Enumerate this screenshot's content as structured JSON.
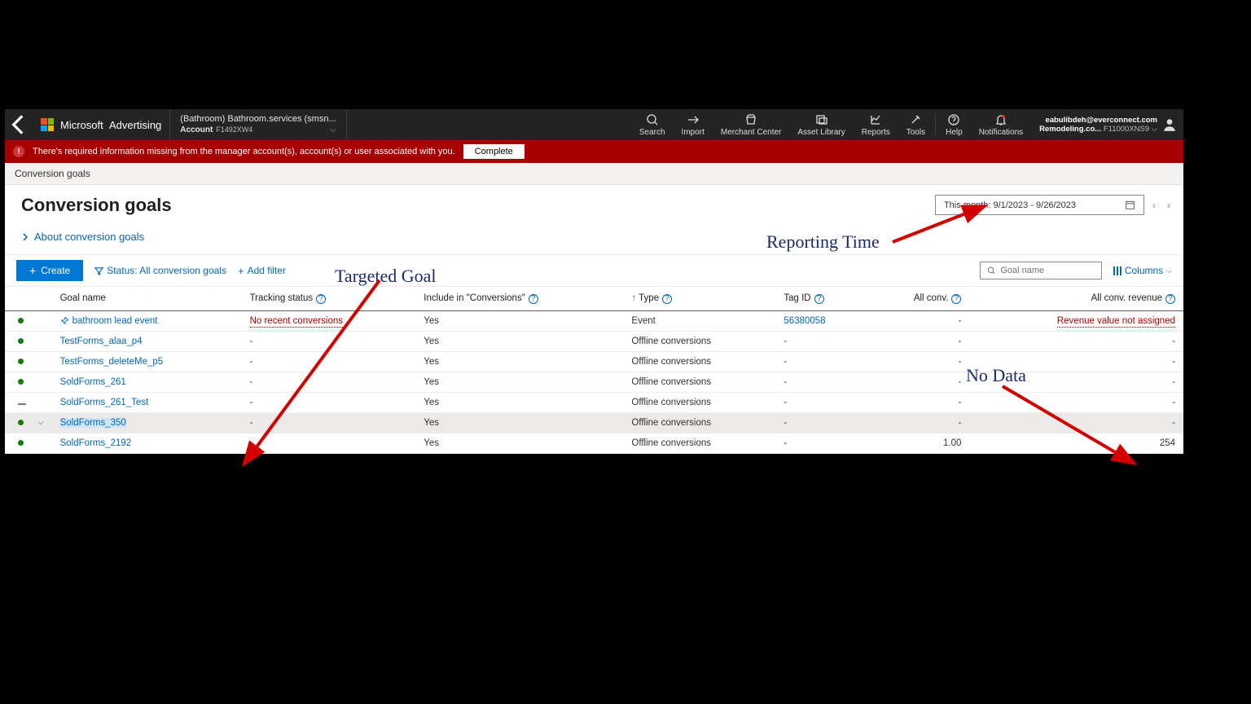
{
  "topbar": {
    "brand": "Microsoft",
    "brand2": "Advertising",
    "acct_line1": "(Bathroom) Bathroom.services (smsn...",
    "acct_label": "Account",
    "acct_id": "F1492XW4",
    "tools": {
      "search": "Search",
      "import": "Import",
      "merchant": "Merchant Center",
      "asset": "Asset Library",
      "reports": "Reports",
      "tools_lbl": "Tools",
      "help": "Help",
      "notifications": "Notifications"
    },
    "user_line1": "eabulibdeh@everconnect.com",
    "user_line2_a": "Remodeling.co...",
    "user_line2_b": "F11000XNS9"
  },
  "alert": {
    "text": "There's required information missing from the manager account(s), account(s) or user associated with you.",
    "button": "Complete"
  },
  "crumb": "Conversion goals",
  "page": {
    "title": "Conversion goals",
    "about": "About conversion goals",
    "date_range": "This month: 9/1/2023 - 9/26/2023"
  },
  "toolbar": {
    "create": "Create",
    "status_filter": "Status: All conversion goals",
    "add_filter": "Add filter",
    "search_placeholder": "Goal name",
    "columns": "Columns"
  },
  "columns": {
    "goal": "Goal name",
    "tracking": "Tracking status",
    "include": "Include in \"Conversions\"",
    "type": "Type",
    "tag": "Tag ID",
    "allconv": "All conv.",
    "allconvrev": "All conv. revenue"
  },
  "rows": [
    {
      "status": "dot",
      "name": "bathroom lead event",
      "pin": true,
      "tracking": "No recent conversions",
      "tracking_warn": true,
      "include": "Yes",
      "type": "Event",
      "tag": "56380058",
      "tag_link": true,
      "allconv": "-",
      "allconvrev": "Revenue value not assigned",
      "rev_warn": true
    },
    {
      "status": "dot",
      "name": "TestForms_alaa_p4",
      "tracking": "-",
      "include": "Yes",
      "type": "Offline conversions",
      "tag": "-",
      "allconv": "-",
      "allconvrev": "-"
    },
    {
      "status": "dot",
      "name": "TestForms_deleteMe_p5",
      "tracking": "-",
      "include": "Yes",
      "type": "Offline conversions",
      "tag": "-",
      "allconv": "-",
      "allconvrev": "-"
    },
    {
      "status": "dot",
      "name": "SoldForms_261",
      "tracking": "-",
      "include": "Yes",
      "type": "Offline conversions",
      "tag": "-",
      "allconv": "-",
      "allconvrev": "-"
    },
    {
      "status": "dash",
      "name": "SoldForms_261_Test",
      "tracking": "-",
      "include": "Yes",
      "type": "Offline conversions",
      "tag": "-",
      "allconv": "-",
      "allconvrev": "-"
    },
    {
      "status": "dot",
      "name": "SoldForms_350",
      "selected": true,
      "chev": true,
      "tracking": "-",
      "include": "Yes",
      "type": "Offline conversions",
      "tag": "-",
      "allconv": "-",
      "allconvrev": "-"
    },
    {
      "status": "dot",
      "name": "SoldForms_2192",
      "tracking": "-",
      "include": "Yes",
      "type": "Offline conversions",
      "tag": "-",
      "allconv": "1.00",
      "allconvrev": "254"
    }
  ],
  "annotations": {
    "targeted": "Targeted Goal",
    "reporting": "Reporting Time",
    "nodata": "No Data"
  }
}
